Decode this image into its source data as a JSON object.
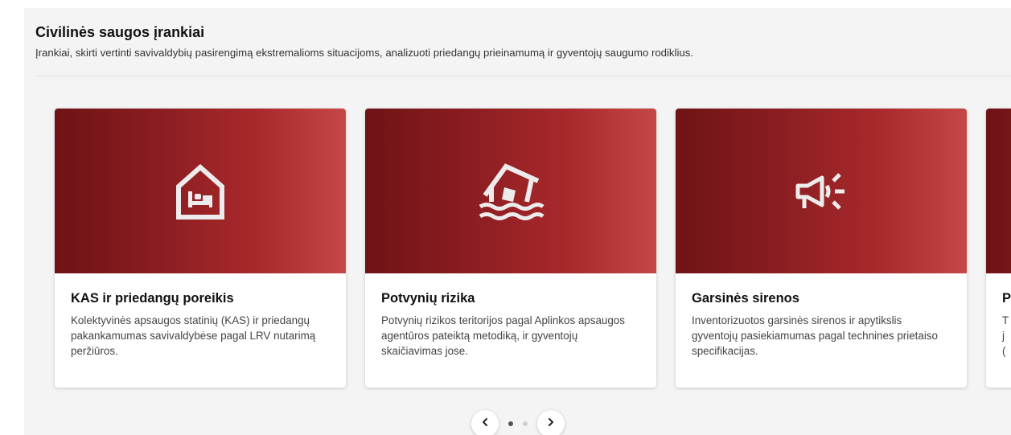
{
  "section": {
    "title": "Civilinės saugos įrankiai",
    "subtitle": "Įrankiai, skirti vertinti savivaldybių pasirengimą ekstremalioms situacijoms, analizuoti priedangų prieinamumą ir gyventojų saugumo rodiklius."
  },
  "cards": [
    {
      "title": "KAS ir priedangų poreikis",
      "description": "Kolektyvinės apsaugos statinių (KAS) ir priedangų pakankamumas savivaldybėse pagal LRV nutarimą peržiūros.",
      "icon": "shelter-bed-icon"
    },
    {
      "title": "Potvynių rizika",
      "description": "Potvynių rizikos teritorijos pagal Aplinkos apsaugos agentūros pateiktą metodiką, ir gyventojų skaičiavimas jose.",
      "icon": "flooded-house-icon"
    },
    {
      "title": "Garsinės sirenos",
      "description": "Inventorizuotos garsinės sirenos ir apytikslis gyventojų pasiekiamumas pagal technines prietaiso specifikacijas.",
      "icon": "megaphone-icon"
    },
    {
      "title": "P",
      "description": "T\nj\n(",
      "icon": ""
    }
  ],
  "pagination": {
    "prev_icon": "chevron-left-icon",
    "next_icon": "chevron-right-icon",
    "pages": 2,
    "current": 1
  },
  "colors": {
    "hero_dark": "#6e1316",
    "hero_light": "#c64747",
    "panel_bg": "#f4f4f4"
  }
}
